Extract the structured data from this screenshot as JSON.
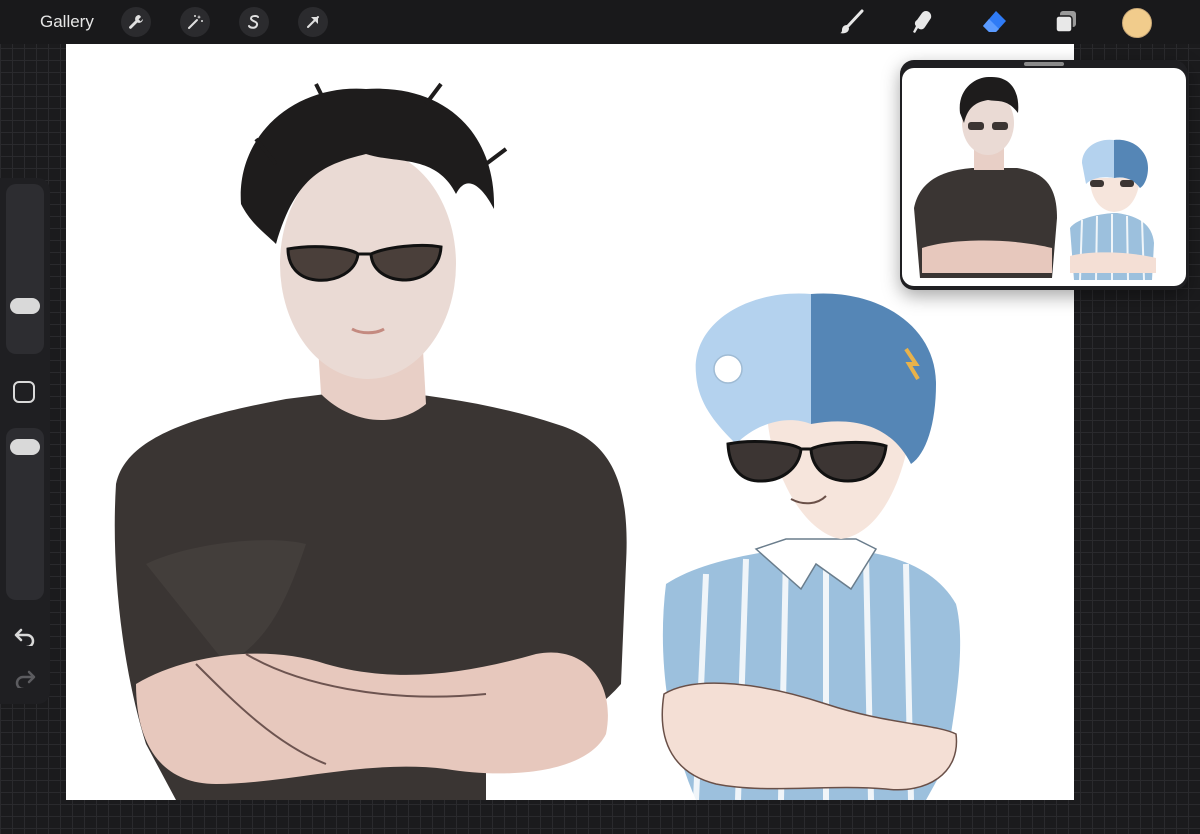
{
  "toolbar": {
    "gallery_label": "Gallery",
    "left_tools": [
      "wrench-icon",
      "magic-wand-icon",
      "selection-icon",
      "transform-arrow-icon"
    ],
    "right_tools": [
      "brush-icon",
      "smudge-icon",
      "eraser-icon",
      "layers-icon"
    ],
    "active_tool": "eraser",
    "current_color": "#f1cc8c",
    "accent_color": "#2f7bf6"
  },
  "sidebar": {
    "brush_size_level": 0.25,
    "opacity_level": 0.95,
    "controls": [
      "modify-button",
      "undo-icon",
      "redo-icon"
    ]
  },
  "reference": {
    "window": "reference-window"
  }
}
